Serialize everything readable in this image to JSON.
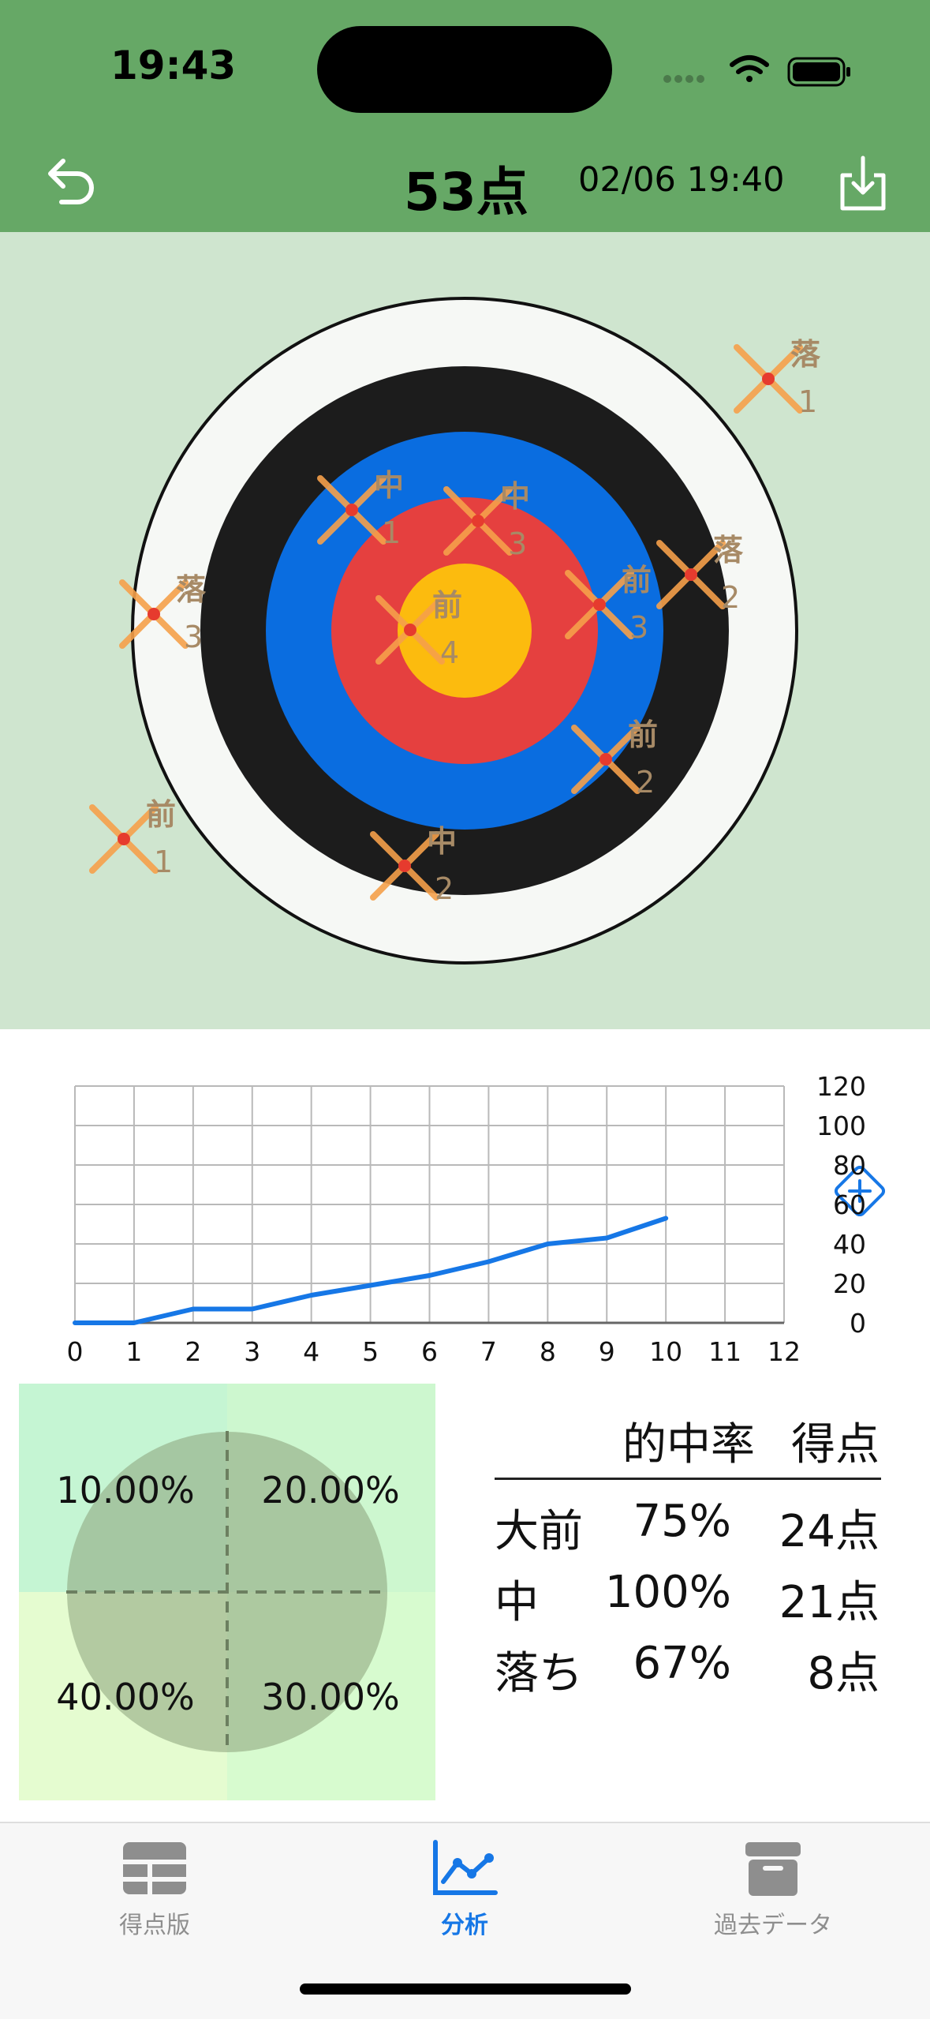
{
  "status_bar": {
    "time": "19:43"
  },
  "header": {
    "score": "53点",
    "datetime": "02/06 19:40"
  },
  "markers": [
    {
      "label": "落",
      "count": "1"
    },
    {
      "label": "中",
      "count": "1"
    },
    {
      "label": "中",
      "count": "3"
    },
    {
      "label": "落",
      "count": "2"
    },
    {
      "label": "落",
      "count": "3"
    },
    {
      "label": "前",
      "count": "4"
    },
    {
      "label": "前",
      "count": "3"
    },
    {
      "label": "前",
      "count": "2"
    },
    {
      "label": "前",
      "count": "1"
    },
    {
      "label": "中",
      "count": "2"
    }
  ],
  "chart_data": {
    "type": "line",
    "x": [
      0,
      1,
      2,
      3,
      4,
      5,
      6,
      7,
      8,
      9,
      10
    ],
    "series": [
      {
        "values": [
          0,
          0,
          7,
          7,
          14,
          19,
          24,
          31,
          40,
          43,
          53
        ]
      }
    ],
    "x_ticks": [
      "0",
      "1",
      "2",
      "3",
      "4",
      "5",
      "6",
      "7",
      "8",
      "9",
      "10",
      "11",
      "12"
    ],
    "y_ticks": [
      "0",
      "20",
      "40",
      "60",
      "80",
      "100",
      "120"
    ],
    "xlim": [
      0,
      12
    ],
    "ylim": [
      0,
      120
    ],
    "grid": true,
    "y_axis_side": "right",
    "line_color": "#1677e6"
  },
  "quadrants": {
    "top_left": "10.00%",
    "top_right": "20.00%",
    "bottom_left": "40.00%",
    "bottom_right": "30.00%"
  },
  "stats_table": {
    "headers": [
      "的中率",
      "得点"
    ],
    "rows": [
      {
        "name": "大前",
        "rate": "75%",
        "score": "24点"
      },
      {
        "name": "中",
        "rate": "100%",
        "score": "21点"
      },
      {
        "name": "落ち",
        "rate": "67%",
        "score": "8点"
      }
    ]
  },
  "tabs": [
    {
      "label": "得点版",
      "icon": "table-icon",
      "active": false
    },
    {
      "label": "分析",
      "icon": "chart-icon",
      "active": true
    },
    {
      "label": "過去データ",
      "icon": "archive-icon",
      "active": false
    }
  ],
  "colors": {
    "header_bg": "#66a866",
    "target_bg": "#cfe5cf",
    "ring_white": "#f6f8f5",
    "ring_black": "#1c1c1c",
    "ring_blue": "#0a6de0",
    "ring_red": "#e5403f",
    "ring_gold": "#fcbb0e",
    "marker_orange": "#f5a04a",
    "marker_text": "#a78a66",
    "accent_blue": "#1677e6"
  }
}
